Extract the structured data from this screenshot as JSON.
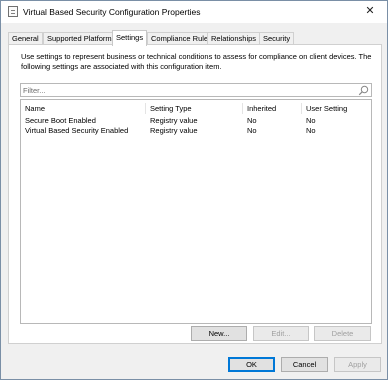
{
  "window": {
    "title": "Virtual Based Security Configuration Properties",
    "close_glyph": "✕"
  },
  "tabs": [
    {
      "label": "General"
    },
    {
      "label": "Supported Platforms"
    },
    {
      "label": "Settings"
    },
    {
      "label": "Compliance Rules"
    },
    {
      "label": "Relationships"
    },
    {
      "label": "Security"
    }
  ],
  "active_tab": "Settings",
  "description": "Use settings to represent business or technical conditions to assess for compliance on client devices. The following settings are associated with this configuration item.",
  "filter": {
    "placeholder": "Filter...",
    "value": ""
  },
  "table": {
    "columns": [
      "Name",
      "Setting Type",
      "Inherited",
      "User Setting"
    ],
    "rows": [
      [
        "Secure Boot Enabled",
        "Registry value",
        "No",
        "No"
      ],
      [
        "Virtual Based Security Enabled",
        "Registry value",
        "No",
        "No"
      ]
    ]
  },
  "list_buttons": {
    "new": "New...",
    "edit": "Edit...",
    "delete": "Delete"
  },
  "dialog_buttons": {
    "ok": "OK",
    "cancel": "Cancel",
    "apply": "Apply"
  },
  "colors": {
    "accent": "#0078d7",
    "disabled_text": "#a0a0a0"
  }
}
